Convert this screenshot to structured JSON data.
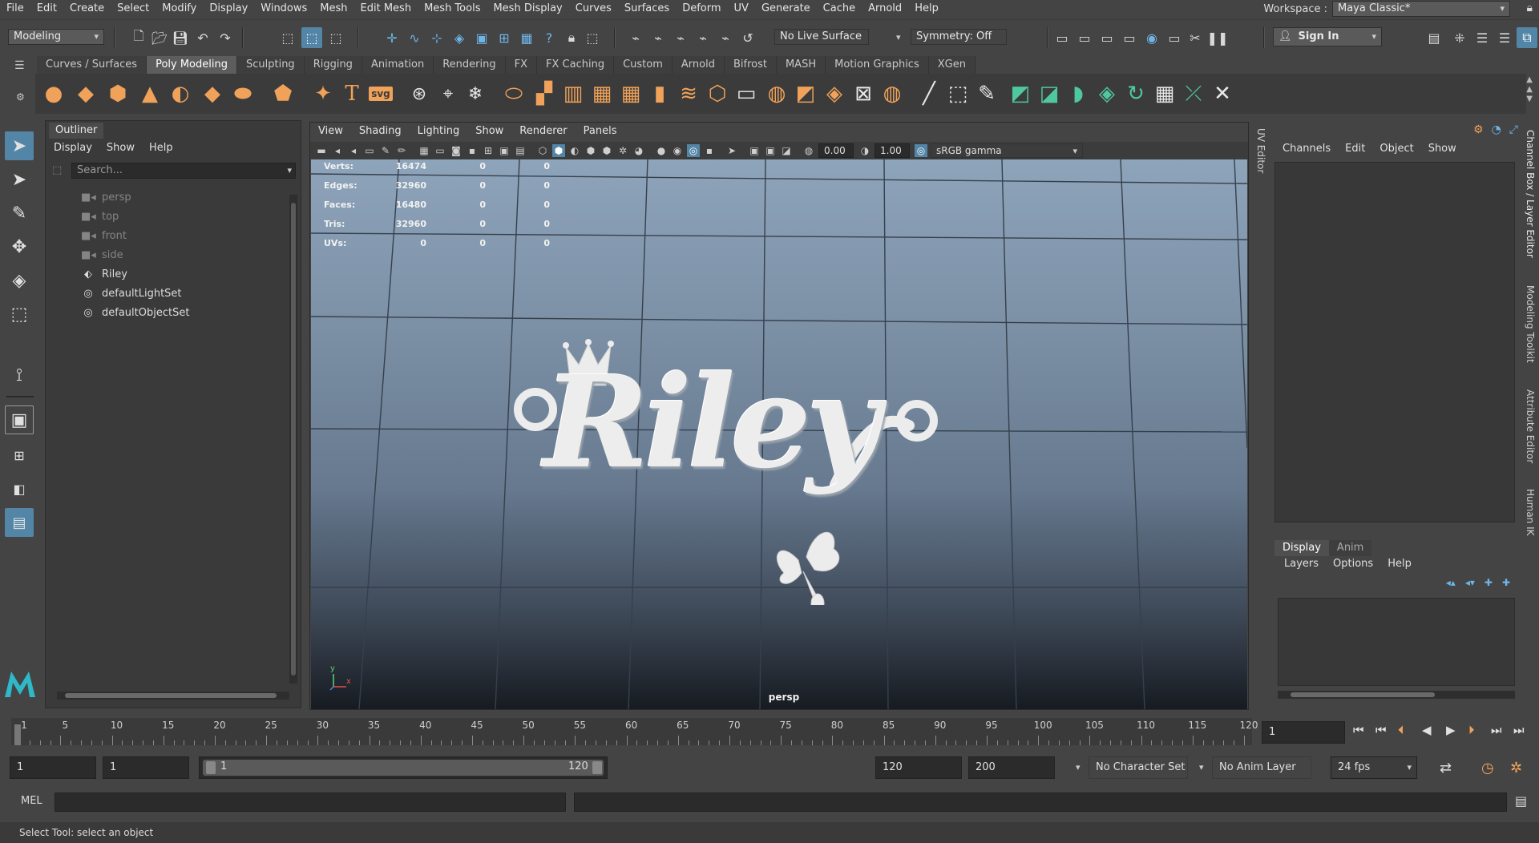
{
  "menubar": {
    "items": [
      "File",
      "Edit",
      "Create",
      "Select",
      "Modify",
      "Display",
      "Windows",
      "Mesh",
      "Edit Mesh",
      "Mesh Tools",
      "Mesh Display",
      "Curves",
      "Surfaces",
      "Deform",
      "UV",
      "Generate",
      "Cache",
      "Arnold",
      "Help"
    ],
    "workspace_label": "Workspace :",
    "workspace_value": "Maya Classic*"
  },
  "statusline": {
    "menuset": "Modeling",
    "live_surface": "No Live Surface",
    "symmetry": "Symmetry: Off",
    "sign_in": "Sign In"
  },
  "shelf": {
    "tabs": [
      "Curves / Surfaces",
      "Poly Modeling",
      "Sculpting",
      "Rigging",
      "Animation",
      "Rendering",
      "FX",
      "FX Caching",
      "Custom",
      "Arnold",
      "Bifrost",
      "MASH",
      "Motion Graphics",
      "XGen"
    ],
    "active_tab": "Poly Modeling",
    "svg_icon_text": "svg"
  },
  "outliner": {
    "title": "Outliner",
    "menu": [
      "Display",
      "Show",
      "Help"
    ],
    "search_placeholder": "Search...",
    "items": [
      {
        "label": "persp",
        "icon": "camera-icon",
        "dim": true
      },
      {
        "label": "top",
        "icon": "camera-icon",
        "dim": true
      },
      {
        "label": "front",
        "icon": "camera-icon",
        "dim": true
      },
      {
        "label": "side",
        "icon": "camera-icon",
        "dim": true
      },
      {
        "label": "Riley",
        "icon": "mesh-transform-icon",
        "dim": false
      },
      {
        "label": "defaultLightSet",
        "icon": "set-icon",
        "dim": false
      },
      {
        "label": "defaultObjectSet",
        "icon": "set-icon",
        "dim": false
      }
    ]
  },
  "viewport": {
    "menu": [
      "View",
      "Shading",
      "Lighting",
      "Show",
      "Renderer",
      "Panels"
    ],
    "field_a": "0.00",
    "field_b": "1.00",
    "color_space": "sRGB gamma",
    "camera_label": "persp",
    "model_text": "Riley",
    "axis_y": "y",
    "axis_x": "x",
    "hud": [
      {
        "label": "Verts:",
        "v1": "16474",
        "v2": "0",
        "v3": "0"
      },
      {
        "label": "Edges:",
        "v1": "32960",
        "v2": "0",
        "v3": "0"
      },
      {
        "label": "Faces:",
        "v1": "16480",
        "v2": "0",
        "v3": "0"
      },
      {
        "label": "Tris:",
        "v1": "32960",
        "v2": "0",
        "v3": "0"
      },
      {
        "label": "UVs:",
        "v1": "0",
        "v2": "0",
        "v3": "0"
      }
    ]
  },
  "side_tabs": {
    "uv_editor": "UV Editor",
    "right": [
      "Channel Box / Layer Editor",
      "Modeling Toolkit",
      "Attribute Editor",
      "Human IK"
    ]
  },
  "channelbox": {
    "menu": [
      "Channels",
      "Edit",
      "Object",
      "Show"
    ],
    "layer_tabs": [
      "Display",
      "Anim"
    ],
    "layer_menu": [
      "Layers",
      "Options",
      "Help"
    ]
  },
  "timeline": {
    "ticks": [
      "1",
      "5",
      "10",
      "15",
      "20",
      "25",
      "30",
      "35",
      "40",
      "45",
      "50",
      "55",
      "60",
      "65",
      "70",
      "75",
      "80",
      "85",
      "90",
      "95",
      "100",
      "105",
      "110",
      "115",
      "120"
    ],
    "current_frame": "1"
  },
  "range": {
    "start": "1",
    "playback_start": "1",
    "slider_start": "1",
    "slider_end": "120",
    "playback_end": "120",
    "end": "200",
    "character_set": "No Character Set",
    "anim_layer": "No Anim Layer",
    "fps": "24 fps"
  },
  "commandline": {
    "label": "MEL"
  },
  "helpline": {
    "text": "Select Tool: select an object"
  },
  "colors": {
    "accent": "#5285a6",
    "shelf_orange": "#f0a25a",
    "shelf_green": "#4fc7a0",
    "maya_logo": "#2fb8c8"
  }
}
